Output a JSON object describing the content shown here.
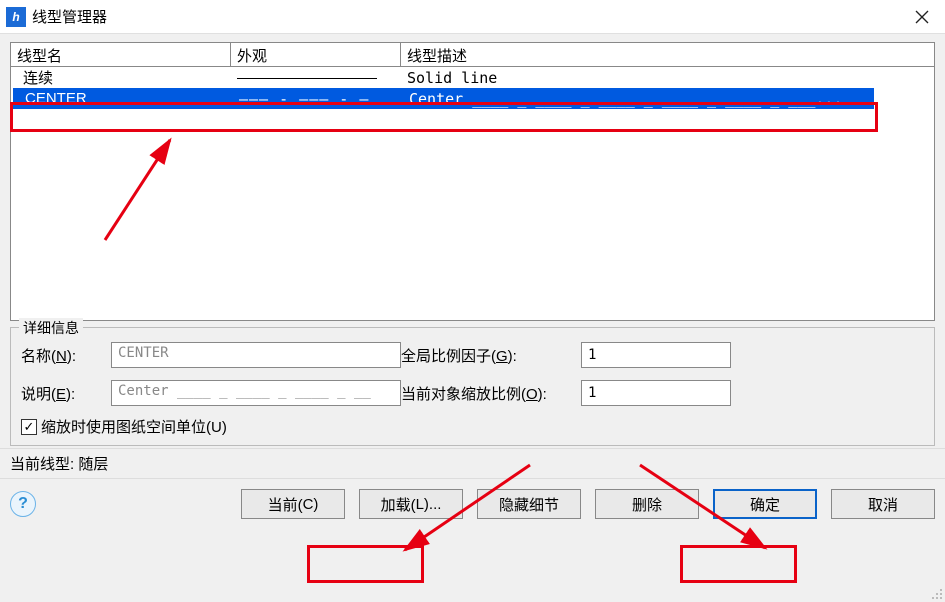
{
  "window": {
    "title": "线型管理器",
    "icon_glyph": "h"
  },
  "list": {
    "headers": {
      "name": "线型名",
      "appearance": "外观",
      "desc": "线型描述"
    },
    "rows": [
      {
        "name": "连续",
        "appearance_kind": "solid",
        "desc": "Solid line",
        "selected": false
      },
      {
        "name": "CENTER",
        "appearance_kind": "center",
        "appearance_text": "——— - ——— - —",
        "desc": "Center ____ _ ____ _ ____ _ ____ _ ____ _ ___...",
        "selected": true
      }
    ]
  },
  "details": {
    "legend": "详细信息",
    "name_label": "名称(N):",
    "name_value": "CENTER",
    "desc_label": "说明(E):",
    "desc_value": "Center ____ _ ____ _ ____ _ __",
    "global_scale_label": "全局比例因子(G):",
    "global_scale_value": "1",
    "object_scale_label": "当前对象缩放比例(O):",
    "object_scale_value": "1",
    "checkbox_label": "缩放时使用图纸空间单位(U)",
    "checkbox_checked": true
  },
  "current_linetype": {
    "label": "当前线型:",
    "value": "随层"
  },
  "buttons": {
    "help": "?",
    "current": "当前(C)",
    "load": "加载(L)...",
    "hide_details": "隐藏细节",
    "delete": "删除",
    "ok": "确定",
    "cancel": "取消"
  }
}
